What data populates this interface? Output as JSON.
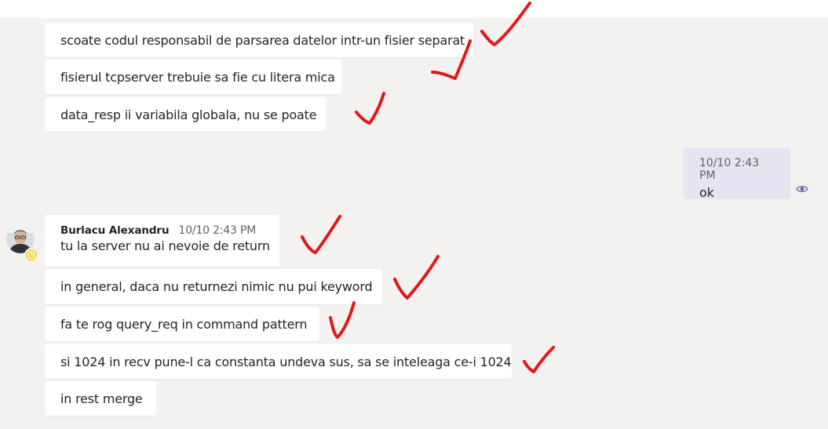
{
  "conversation": {
    "previous_messages": [
      "scoate codul responsabil de parsarea datelor intr-un fisier separat",
      "fisierul tcpserver trebuie sa fie cu litera mica",
      "data_resp ii variabila globala, nu se poate"
    ],
    "my_message": {
      "time": "10/10 2:43 PM",
      "text": "ok"
    },
    "reply": {
      "author": "Burlacu Alexandru",
      "time": "10/10 2:43 PM",
      "first_text": "tu la server nu ai nevoie de return",
      "messages": [
        "in general, daca nu returnezi nimic nu pui keyword",
        "fa te rog query_req in command pattern",
        "si 1024 in recv pune-l ca constanta undeva sus, sa se inteleaga ce-i 1024",
        "in rest merge"
      ]
    }
  },
  "icons": {
    "seen": "eye-icon",
    "status": "clock-icon",
    "annotation": "checkmark-icon"
  },
  "colors": {
    "background": "#f3f2f1",
    "bubble": "#ffffff",
    "my_bubble": "#e5e5f1",
    "annotation": "#e0191b",
    "seen_icon": "#6264a7",
    "status_away": "#f8d22a"
  }
}
